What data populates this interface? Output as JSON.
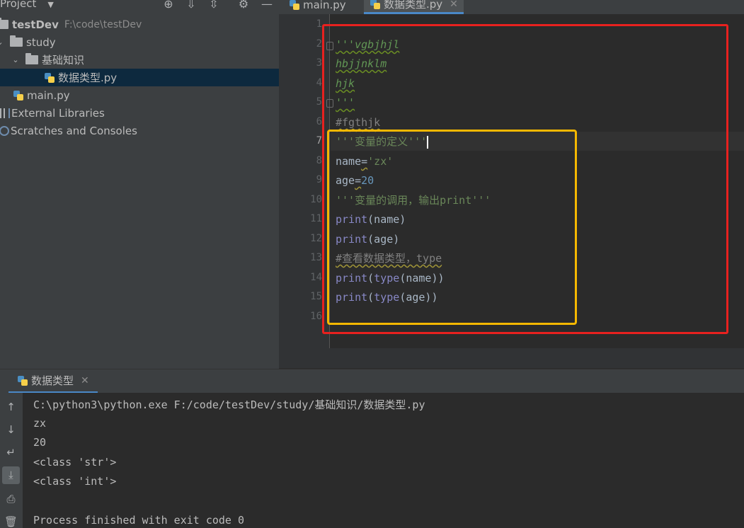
{
  "project": {
    "title": "Project",
    "tree": [
      {
        "label": "testDev",
        "path": "F:\\code\\testDev"
      },
      {
        "label": "study"
      },
      {
        "label": "基础知识"
      },
      {
        "label": "数据类型.py"
      },
      {
        "label": "main.py"
      },
      {
        "label": "External Libraries"
      },
      {
        "label": "Scratches and Consoles"
      }
    ]
  },
  "tabs": [
    {
      "label": "main.py"
    },
    {
      "label": "数据类型.py"
    }
  ],
  "editor": {
    "line_numbers": [
      "1",
      "2",
      "3",
      "4",
      "5",
      "6",
      "7",
      "8",
      "9",
      "10",
      "11",
      "12",
      "13",
      "14",
      "15",
      "16"
    ],
    "lines": {
      "l2": "'''vgbjhjl",
      "l3": "hbjjnklm",
      "l4": "hjk",
      "l5": "'''",
      "l6": "#fgthjk",
      "l7": "'''变量的定义'''",
      "l8_name": "name",
      "l8_eq": "=",
      "l8_str": "'zx'",
      "l9_name": "age",
      "l9_eq": "=",
      "l9_num": "20",
      "l10": "'''变量的调用，输出print'''",
      "l11_fn": "print",
      "l11_arg": "(name)",
      "l12_fn": "print",
      "l12_arg": "(age)",
      "l13": "#查看数据类型，type",
      "l14_fn": "print",
      "l14_p": "(",
      "l14_fn2": "type",
      "l14_arg": "(name))",
      "l15_fn": "print",
      "l15_p": "(",
      "l15_fn2": "type",
      "l15_arg": "(age))"
    }
  },
  "run": {
    "tab_label": "数据类型",
    "output": [
      "C:\\python3\\python.exe F:/code/testDev/study/基础知识/数据类型.py",
      "zx",
      "20",
      "<class 'str'>",
      "<class 'int'>",
      "",
      "Process finished with exit code 0"
    ]
  },
  "colors": {
    "annotation_red": "#e8211f",
    "annotation_yellow": "#f5b800"
  }
}
